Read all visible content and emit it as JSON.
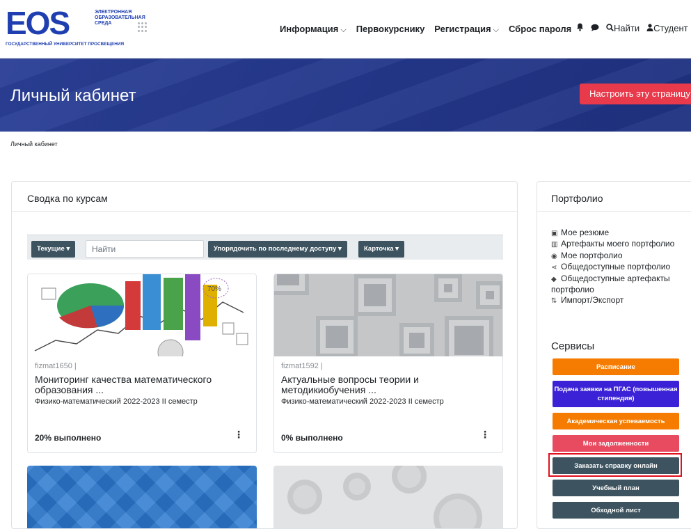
{
  "logo": {
    "mark": "EOS",
    "subtitle": "ЭЛЕКТРОННАЯ ОБРАЗОВАТЕЛЬНАЯ СРЕДА",
    "university": "ГОСУДАРСТВЕННЫЙ УНИВЕРСИТЕТ ПРОСВЕЩЕНИЯ"
  },
  "nav": {
    "items": [
      {
        "label": "Информация",
        "dropdown": true
      },
      {
        "label": "Первокурснику",
        "dropdown": false
      },
      {
        "label": "Регистрация",
        "dropdown": true
      },
      {
        "label": "Сброс пароля",
        "dropdown": false
      }
    ],
    "search_label": "Найти",
    "user_label": "Студент"
  },
  "banner": {
    "title": "Личный кабинет",
    "customize_button": "Настроить эту страницу"
  },
  "breadcrumb": "Личный кабинет",
  "course_overview": {
    "title": "Сводка по курсам",
    "filter_current": "Текущие",
    "search_placeholder": "Найти",
    "sort_button": "Упорядочить по последнему доступу",
    "view_button": "Карточка",
    "courses": [
      {
        "short": "fizmat1650 |",
        "name": "Мониторинг качества математического образования ...",
        "category": "Физико-математический 2022-2023 II семестр",
        "progress": "20% выполнено"
      },
      {
        "short": "fizmat1592 |",
        "name": "Актуальные вопросы теории и методикиобучения ...",
        "category": "Физико-математический 2022-2023 II семестр",
        "progress": "0% выполнено"
      }
    ]
  },
  "portfolio": {
    "title": "Портфолио",
    "items": [
      {
        "icon": "resume-icon",
        "label": "Мое резюме"
      },
      {
        "icon": "artifacts-icon",
        "label": "Артефакты моего портфолио"
      },
      {
        "icon": "eye-icon",
        "label": "Мое портфолио"
      },
      {
        "icon": "share-icon",
        "label": "Общедоступные портфолио"
      },
      {
        "icon": "tag-icon",
        "label": "Общедоступные артефакты портфолио"
      },
      {
        "icon": "sort-icon",
        "label": "Импорт/Экспорт"
      }
    ]
  },
  "services": {
    "title": "Сервисы",
    "buttons": [
      {
        "label": "Расписание",
        "color": "#f57c00"
      },
      {
        "label": "Подача заявки на ПГАС (повышенная стипендия)",
        "color": "#3b22d6"
      },
      {
        "label": "Академическая успеваемость",
        "color": "#f57c00"
      },
      {
        "label": "Мои задолженности",
        "color": "#e84a5f"
      },
      {
        "label": "Заказать справку онлайн",
        "color": "#3d5460"
      },
      {
        "label": "Учебный план",
        "color": "#3d5460"
      },
      {
        "label": "Обходной лист",
        "color": "#3d5460"
      }
    ]
  },
  "colors": {
    "brand": "#1f3fb0",
    "banner": "#2b3f96",
    "danger": "#e83a4b",
    "dark_button": "#3d5460"
  }
}
